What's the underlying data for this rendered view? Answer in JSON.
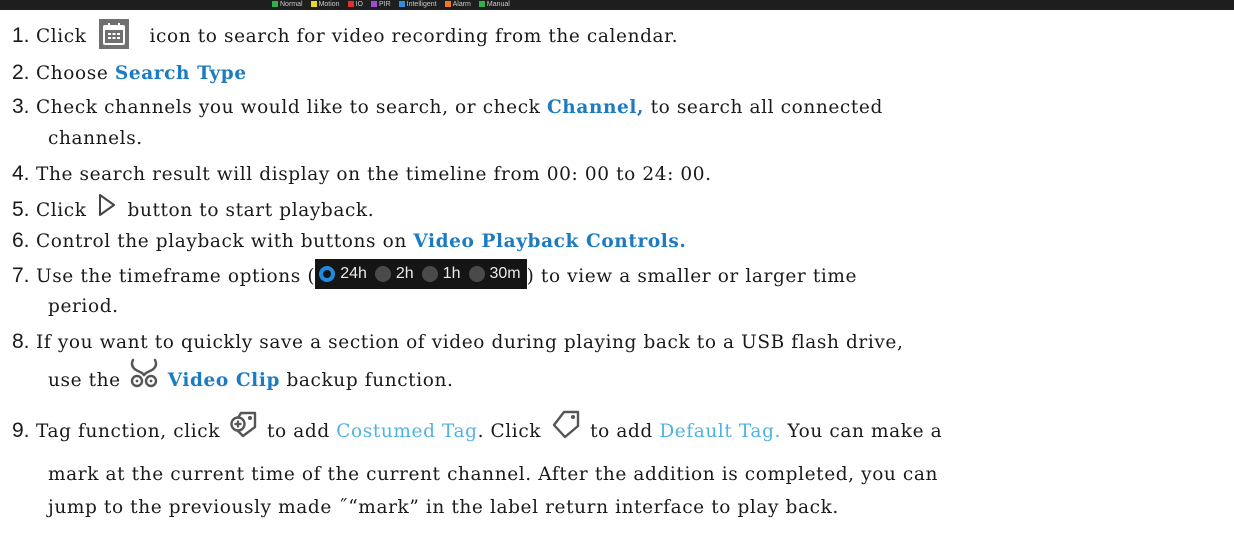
{
  "legend": [
    {
      "label": "Normal",
      "color": "#2fb24a"
    },
    {
      "label": "Motion",
      "color": "#e8d52a"
    },
    {
      "label": "IO",
      "color": "#e03030"
    },
    {
      "label": "PIR",
      "color": "#9b4dd6"
    },
    {
      "label": "Intelligent",
      "color": "#2f8ee0"
    },
    {
      "label": "Alarm",
      "color": "#f07a1a"
    },
    {
      "label": "Manual",
      "color": "#2fb24a"
    }
  ],
  "steps": {
    "s1": {
      "num": "1.",
      "pre": "Click",
      "post": "icon to search for video recording from the calendar.",
      "icon": "calendar-icon"
    },
    "s2": {
      "num": "2.",
      "pre": "Choose ",
      "kw": "Search Type"
    },
    "s3": {
      "num": "3.",
      "pre": "Check channels you would like to search, or check ",
      "kw": "Channel,",
      "post": " to search all connected",
      "cont": "channels."
    },
    "s4": {
      "num": "4.",
      "text": "The search result will display on the timeline from 00: 00 to 24: 00."
    },
    "s5": {
      "num": "5.",
      "pre": "Click",
      "post": "button to start playback.",
      "icon": "play-icon"
    },
    "s6": {
      "num": "6.",
      "pre": "Control the playback with buttons on ",
      "kw": "Video Playback Controls."
    },
    "s7": {
      "num": "7.",
      "pre": "Use the timeframe options (",
      "post": ") to view a smaller or larger time",
      "cont": "period.",
      "options": [
        {
          "label": "24h",
          "selected": true
        },
        {
          "label": "2h",
          "selected": false
        },
        {
          "label": "1h",
          "selected": false
        },
        {
          "label": "30m",
          "selected": false
        }
      ]
    },
    "s8": {
      "num": "8.",
      "text": "If you want to quickly save a section of video during playing back to a USB flash drive,",
      "cont_pre": "use the",
      "kw": "Video Clip",
      "cont_post": " backup function.",
      "icon": "scissors-icon"
    },
    "s9": {
      "num": "9.",
      "pre": "Tag function, click",
      "mid1": "to add ",
      "kw1": "Costumed Tag",
      "mid2": ". Click",
      "mid3": "to add ",
      "kw2": "Default Tag.",
      "post": " You can make a",
      "cont1": "mark at the current time of the current channel. After the addition is completed, you can",
      "cont2": "jump to the previously made ˝“mark” in the label return interface to play back."
    }
  }
}
